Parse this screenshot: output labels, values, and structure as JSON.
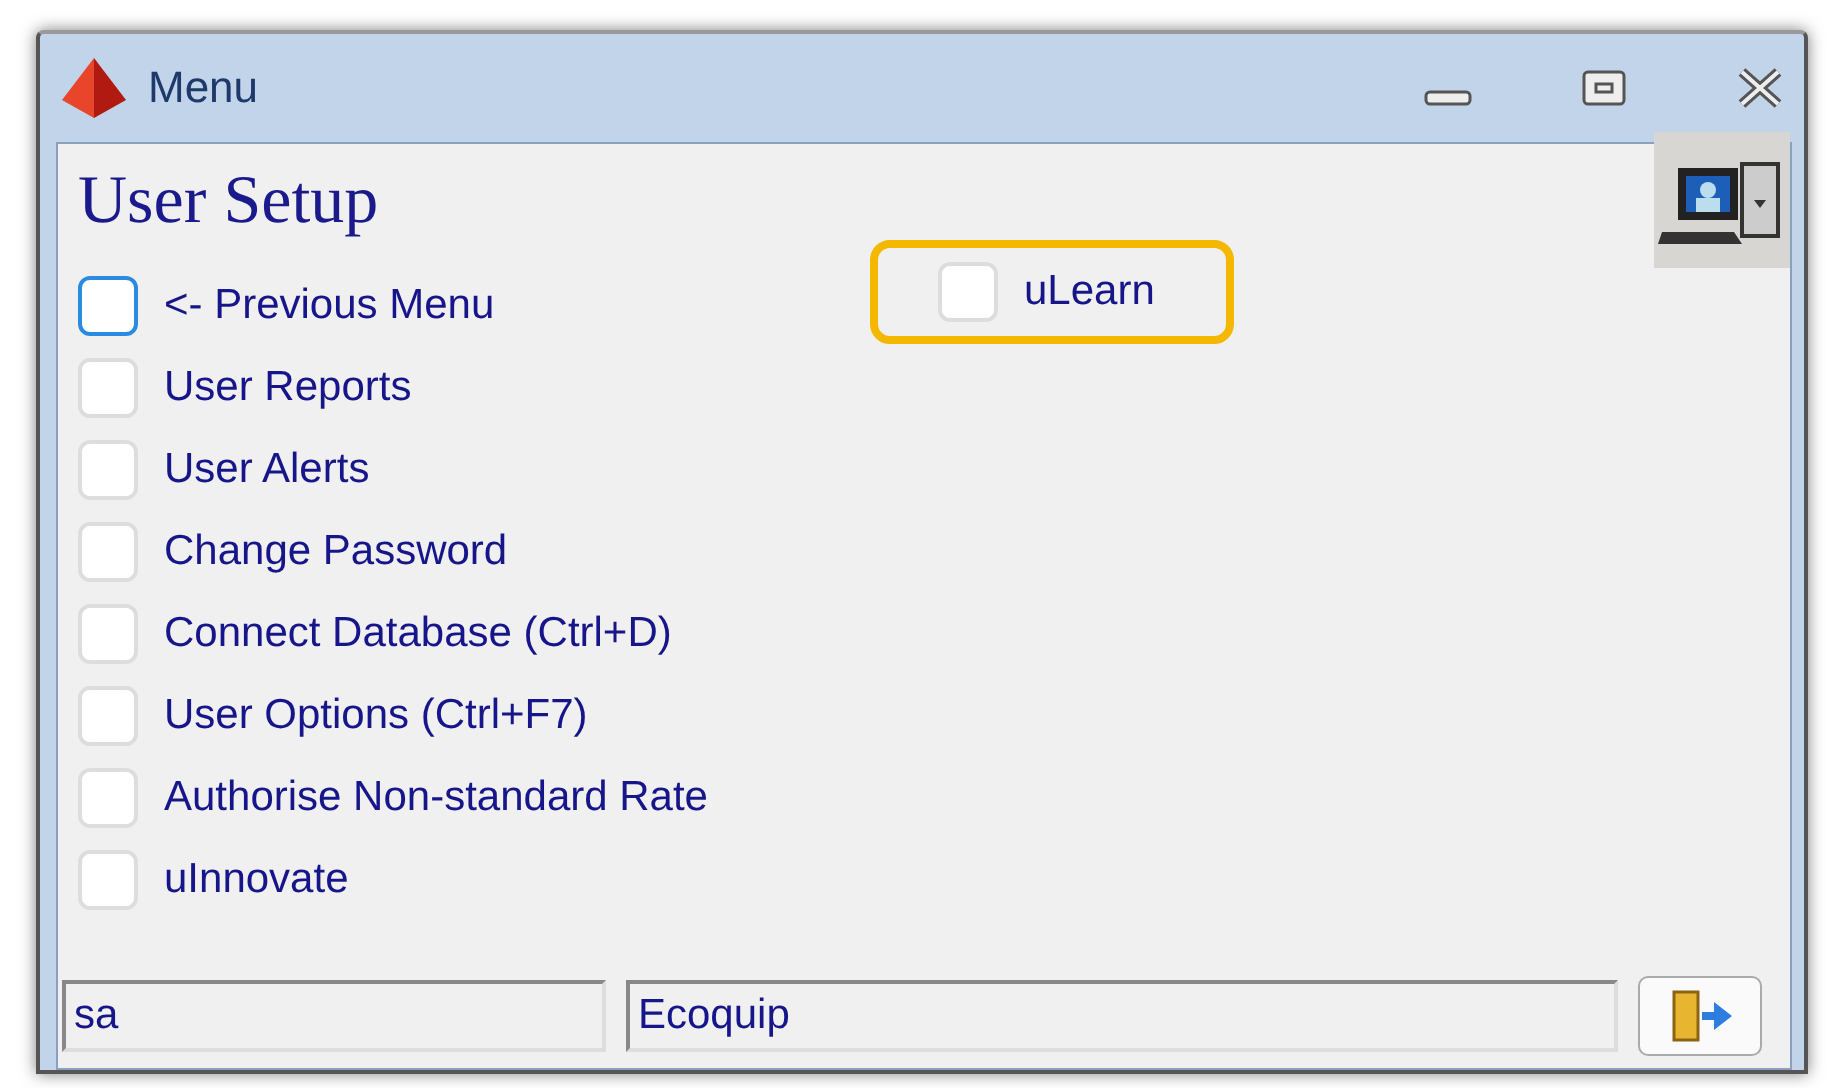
{
  "window": {
    "title": "Menu"
  },
  "heading": "User Setup",
  "columns": [
    [
      {
        "label": "<- Previous Menu",
        "focused": true,
        "highlighted": false
      },
      {
        "label": "User Reports",
        "focused": false,
        "highlighted": false
      },
      {
        "label": "User Alerts",
        "focused": false,
        "highlighted": false
      },
      {
        "label": "Change Password",
        "focused": false,
        "highlighted": false
      },
      {
        "label": "Connect Database (Ctrl+D)",
        "focused": false,
        "highlighted": false
      },
      {
        "label": "User Options (Ctrl+F7)",
        "focused": false,
        "highlighted": false
      },
      {
        "label": "Authorise Non-standard Rate",
        "focused": false,
        "highlighted": false
      },
      {
        "label": "uInnovate",
        "focused": false,
        "highlighted": false
      }
    ],
    [
      {
        "label": "uLearn",
        "focused": false,
        "highlighted": true
      }
    ]
  ],
  "status_bar": {
    "user": "sa",
    "company": "Ecoquip"
  }
}
